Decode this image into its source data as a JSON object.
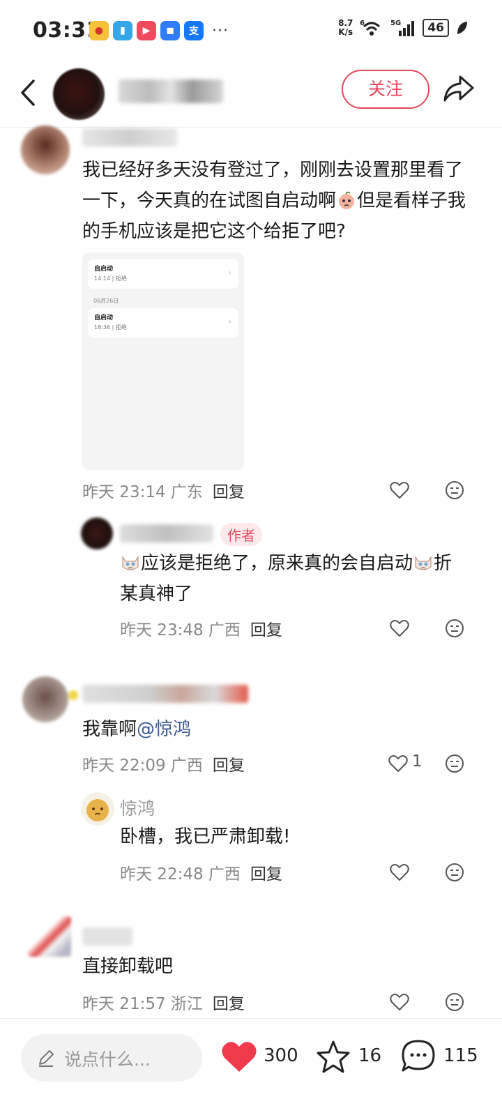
{
  "status_bar": {
    "time": "03:31",
    "net_speed_value": "8.7",
    "net_speed_unit": "K/s",
    "wifi_label": "6",
    "signal_label": "5G",
    "battery": "46"
  },
  "header": {
    "follow_label": "关注"
  },
  "comments": [
    {
      "text": "我已经好多天没有登过了，刚刚去设置那里看了一下，今天真的在试图自启动啊",
      "text_after": "但是看样子我的手机应该是把它这个给拒了吧?",
      "time": "昨天 23:14",
      "location": "广东",
      "reply_label": "回复"
    },
    {
      "author_tag": "作者",
      "text_before": "",
      "text": "应该是拒绝了，原来真的会自启动",
      "text_after": "折某真神了",
      "time": "昨天 23:48",
      "location": "广西",
      "reply_label": "回复"
    },
    {
      "text": "我靠啊",
      "mention": "@惊鸿",
      "time": "昨天 22:09",
      "location": "广西",
      "reply_label": "回复",
      "likes": "1"
    },
    {
      "username": "惊鸿",
      "text": "卧槽，我已严肃卸载!",
      "time": "昨天 22:48",
      "location": "广西",
      "reply_label": "回复"
    },
    {
      "text": "直接卸载吧",
      "time": "昨天 21:57",
      "location": "浙江",
      "reply_label": "回复"
    }
  ],
  "attached_screenshot": {
    "item1_title": "自启动",
    "item1_sub": "14:14 | 拒绝",
    "date": "06月26日",
    "item2_title": "自启动",
    "item2_sub": "18:36 | 拒绝"
  },
  "bottom_bar": {
    "input_placeholder": "说点什么...",
    "likes": "300",
    "favorites": "16",
    "comments": "115"
  },
  "colors": {
    "accent_red": "#e2485a",
    "mention_blue": "#3a5896"
  }
}
